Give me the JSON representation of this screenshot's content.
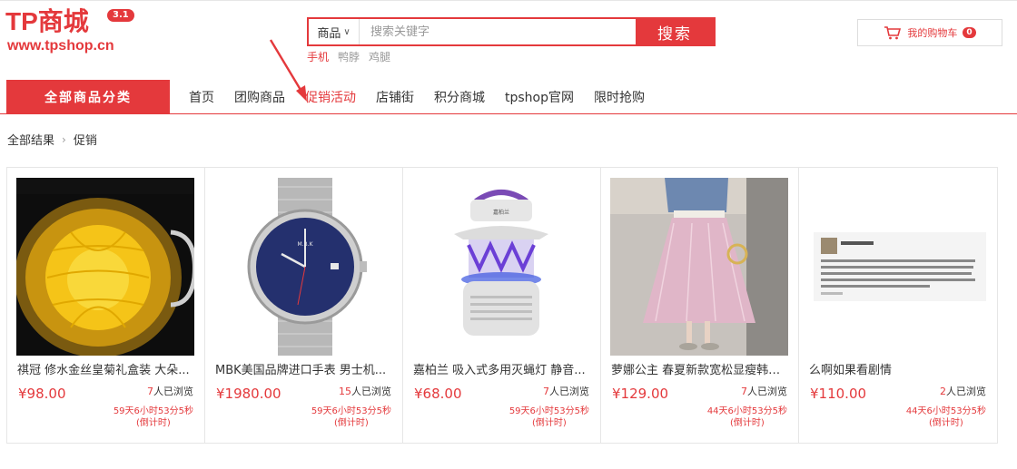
{
  "logo": {
    "main": "TP商城",
    "badge": "3.1",
    "url": "www.tpshop.cn"
  },
  "search": {
    "category": "商品",
    "placeholder": "搜索关键字",
    "button": "搜索",
    "hot": [
      "手机",
      "鸭脖",
      "鸡腿"
    ]
  },
  "cart": {
    "label": "我的购物车",
    "count": "0"
  },
  "nav": {
    "all_categories": "全部商品分类",
    "items": [
      "首页",
      "团购商品",
      "促销活动",
      "店铺街",
      "积分商城",
      "tpshop官网",
      "限时抢购"
    ],
    "active_index": 2
  },
  "breadcrumb": {
    "root": "全部结果",
    "current": "促销"
  },
  "products": [
    {
      "name": "祺冠 修水金丝皇菊礼盒装 大朵...",
      "price": "¥98.00",
      "views_num": "7",
      "views_label": "人已浏览",
      "countdown": "59天6小时53分5秒",
      "countdown_note": "(倒计时)"
    },
    {
      "name": "MBK美国品牌进口手表 男士机...",
      "price": "¥1980.00",
      "views_num": "15",
      "views_label": "人已浏览",
      "countdown": "59天6小时53分5秒",
      "countdown_note": "(倒计时)"
    },
    {
      "name": "嘉柏兰 吸入式多用灭蝇灯 静音...",
      "price": "¥68.00",
      "views_num": "7",
      "views_label": "人已浏览",
      "countdown": "59天6小时53分5秒",
      "countdown_note": "(倒计时)"
    },
    {
      "name": "萝娜公主 春夏新款宽松显瘦韩版...",
      "price": "¥129.00",
      "views_num": "7",
      "views_label": "人已浏览",
      "countdown": "44天6小时53分5秒",
      "countdown_note": "(倒计时)"
    },
    {
      "name": "么啊如果看剧情",
      "price": "¥110.00",
      "views_num": "2",
      "views_label": "人已浏览",
      "countdown": "44天6小时53分5秒",
      "countdown_note": "(倒计时)"
    }
  ],
  "colors": {
    "brand": "#e4393c"
  }
}
